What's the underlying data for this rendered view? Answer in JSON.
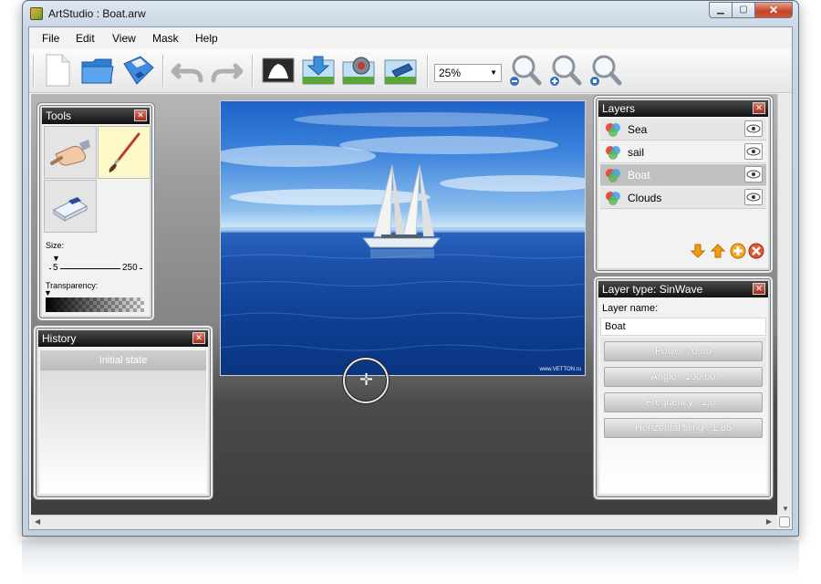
{
  "window": {
    "title": "ArtStudio : Boat.arw"
  },
  "menu": {
    "items": [
      "File",
      "Edit",
      "View",
      "Mask",
      "Help"
    ]
  },
  "toolbar": {
    "buttons": [
      "new-document-icon",
      "open-folder-icon",
      "save-disk-icon",
      "undo-arrow-icon",
      "redo-arrow-icon",
      "mask-tool-icon",
      "import-image-icon",
      "layer-effect-icon",
      "export-image-icon"
    ],
    "zoom": "25%",
    "zoom_buttons": [
      "zoom-out-icon",
      "zoom-in-icon",
      "zoom-fit-icon"
    ]
  },
  "tools": {
    "title": "Tools",
    "items": [
      "hand-tool-icon",
      "brush-tool-icon",
      "eraser-tool-icon"
    ],
    "size_label": "Size:",
    "size_min": "5",
    "size_max": "250",
    "transparency_label": "Transparency:"
  },
  "history": {
    "title": "History",
    "items": [
      "Initial state"
    ]
  },
  "canvas": {
    "watermark": "www.VETTON.ru"
  },
  "layers": {
    "title": "Layers",
    "items": [
      {
        "name": "Sea"
      },
      {
        "name": "sail"
      },
      {
        "name": "Boat"
      },
      {
        "name": "Clouds"
      }
    ],
    "selected": "Boat",
    "actions": [
      "move-down-icon",
      "move-up-icon",
      "add-layer-icon",
      "delete-layer-icon"
    ]
  },
  "properties": {
    "title": "Layer type: SinWave",
    "layer_name_label": "Layer name:",
    "layer_name_value": "Boat",
    "params": [
      "Power : 0,86",
      "Angle : 100,00",
      "Frequency : 1,00",
      "Horizontal tiling : 1,85"
    ]
  },
  "colors": {
    "panel_header": "#1a1a1a",
    "selected_tool_bg": "#fcf8c8",
    "close_red": "#c6412a"
  }
}
